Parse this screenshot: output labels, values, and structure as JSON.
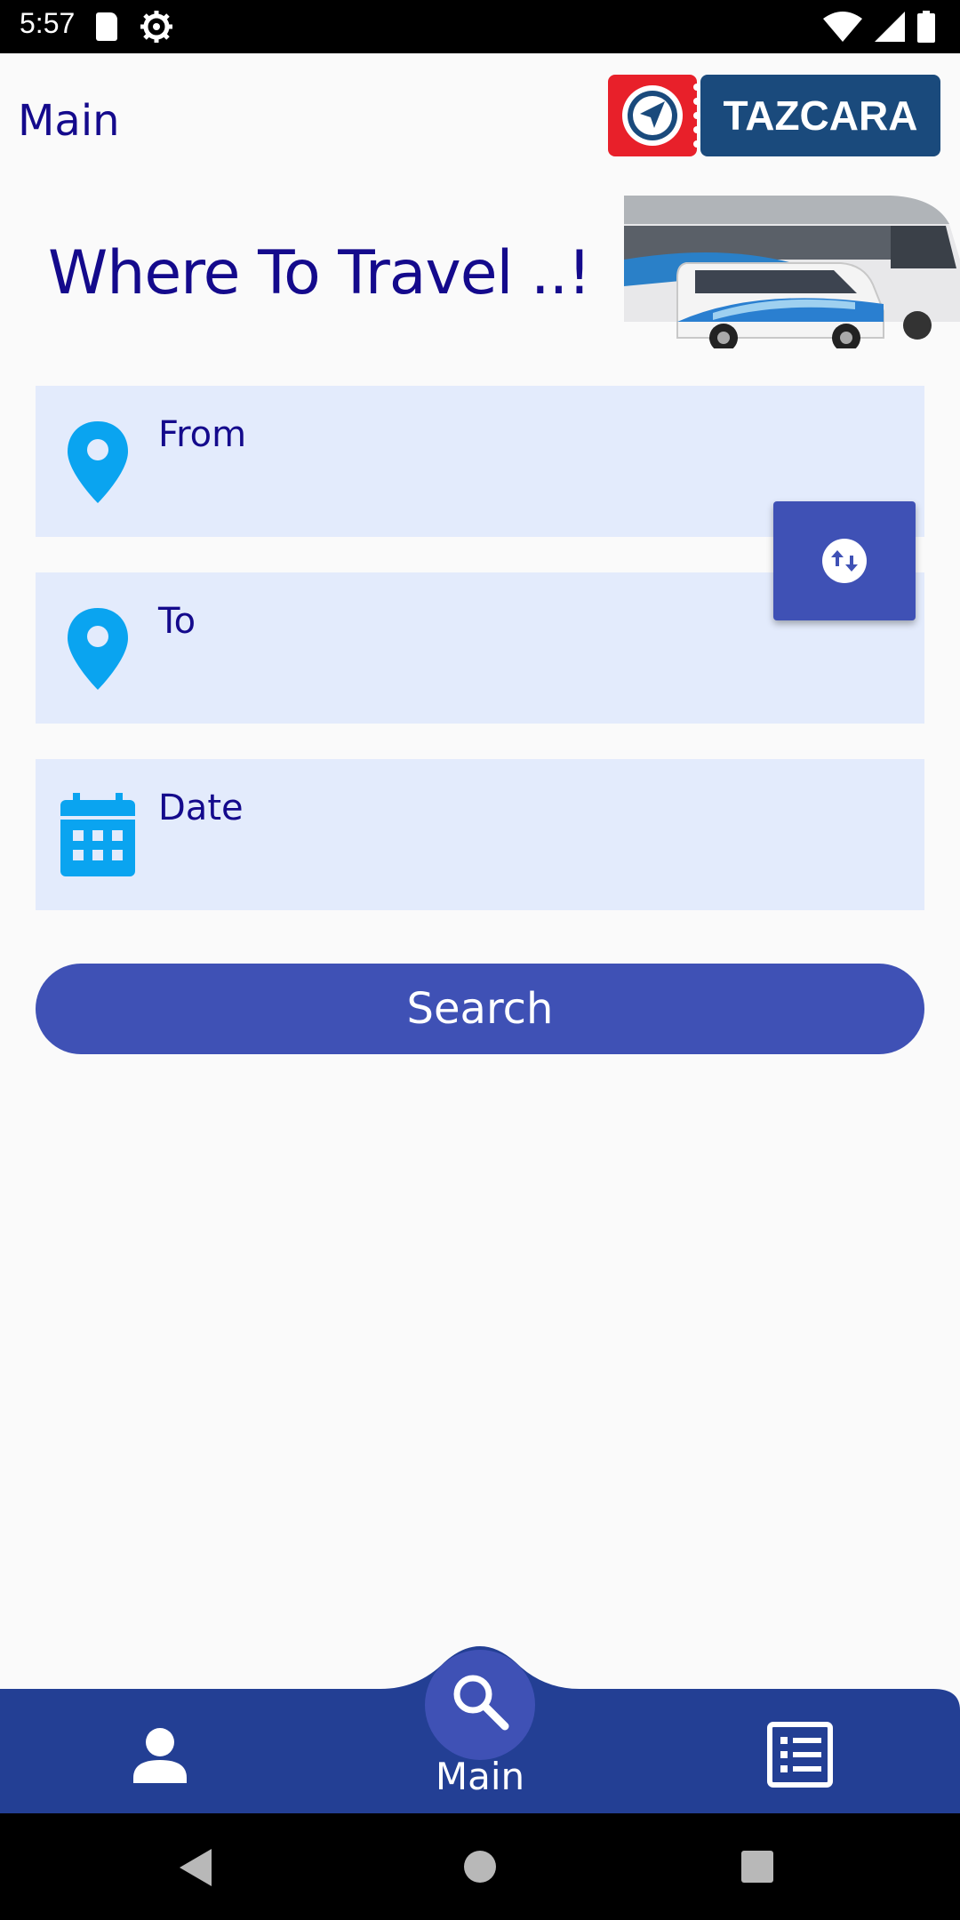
{
  "status_bar": {
    "time": "5:57",
    "icons": [
      "sd-card-icon",
      "settings-gear-icon",
      "wifi-icon",
      "signal-icon",
      "battery-icon"
    ]
  },
  "header": {
    "title": "Main",
    "brand": "TAZCARA"
  },
  "hero": {
    "title": "Where To Travel ..!"
  },
  "form": {
    "from_label": "From",
    "to_label": "To",
    "date_label": "Date",
    "search_label": "Search"
  },
  "bottom_nav": {
    "items": [
      {
        "name": "profile",
        "icon": "person-icon"
      },
      {
        "name": "main",
        "label": "Main",
        "icon": "search-icon"
      },
      {
        "name": "bookings",
        "icon": "list-icon"
      }
    ]
  },
  "colors": {
    "primary": "#3f51b5",
    "nav_bar": "#233f94",
    "text_dark_blue": "#140a8c",
    "field_bg": "#e3ebfc",
    "pin": "#0aa4f0",
    "logo_red": "#e8202a",
    "logo_navy": "#1a4a7c"
  }
}
